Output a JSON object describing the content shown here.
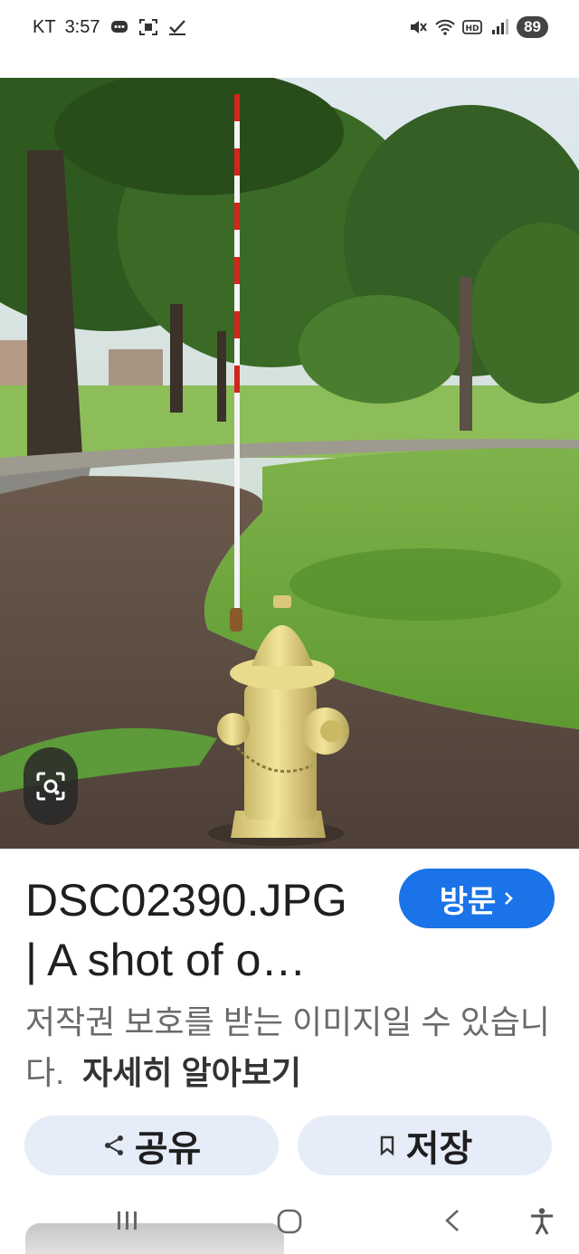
{
  "status_bar": {
    "carrier": "KT",
    "time": "3:57",
    "battery": "89",
    "icons": [
      "message-icon",
      "screenshot-icon",
      "check-icon",
      "mute-icon",
      "wifi-icon",
      "hd-icon",
      "signal-icon"
    ]
  },
  "image": {
    "description_icon": "lens-icon"
  },
  "result": {
    "title_line1": "DSC02390.JPG",
    "title_line2": "| A shot of o…",
    "visit_label": "방문",
    "visit_icon": "chevron-right-icon",
    "copyright_text": "저작권 보호를 받는 이미지일 수 있습니다.",
    "learn_more": "자세히 알아보기"
  },
  "actions": {
    "share_label": "공유",
    "save_label": "저장"
  },
  "colors": {
    "accent": "#1a73e8",
    "action_bg": "#e6ecf8"
  }
}
